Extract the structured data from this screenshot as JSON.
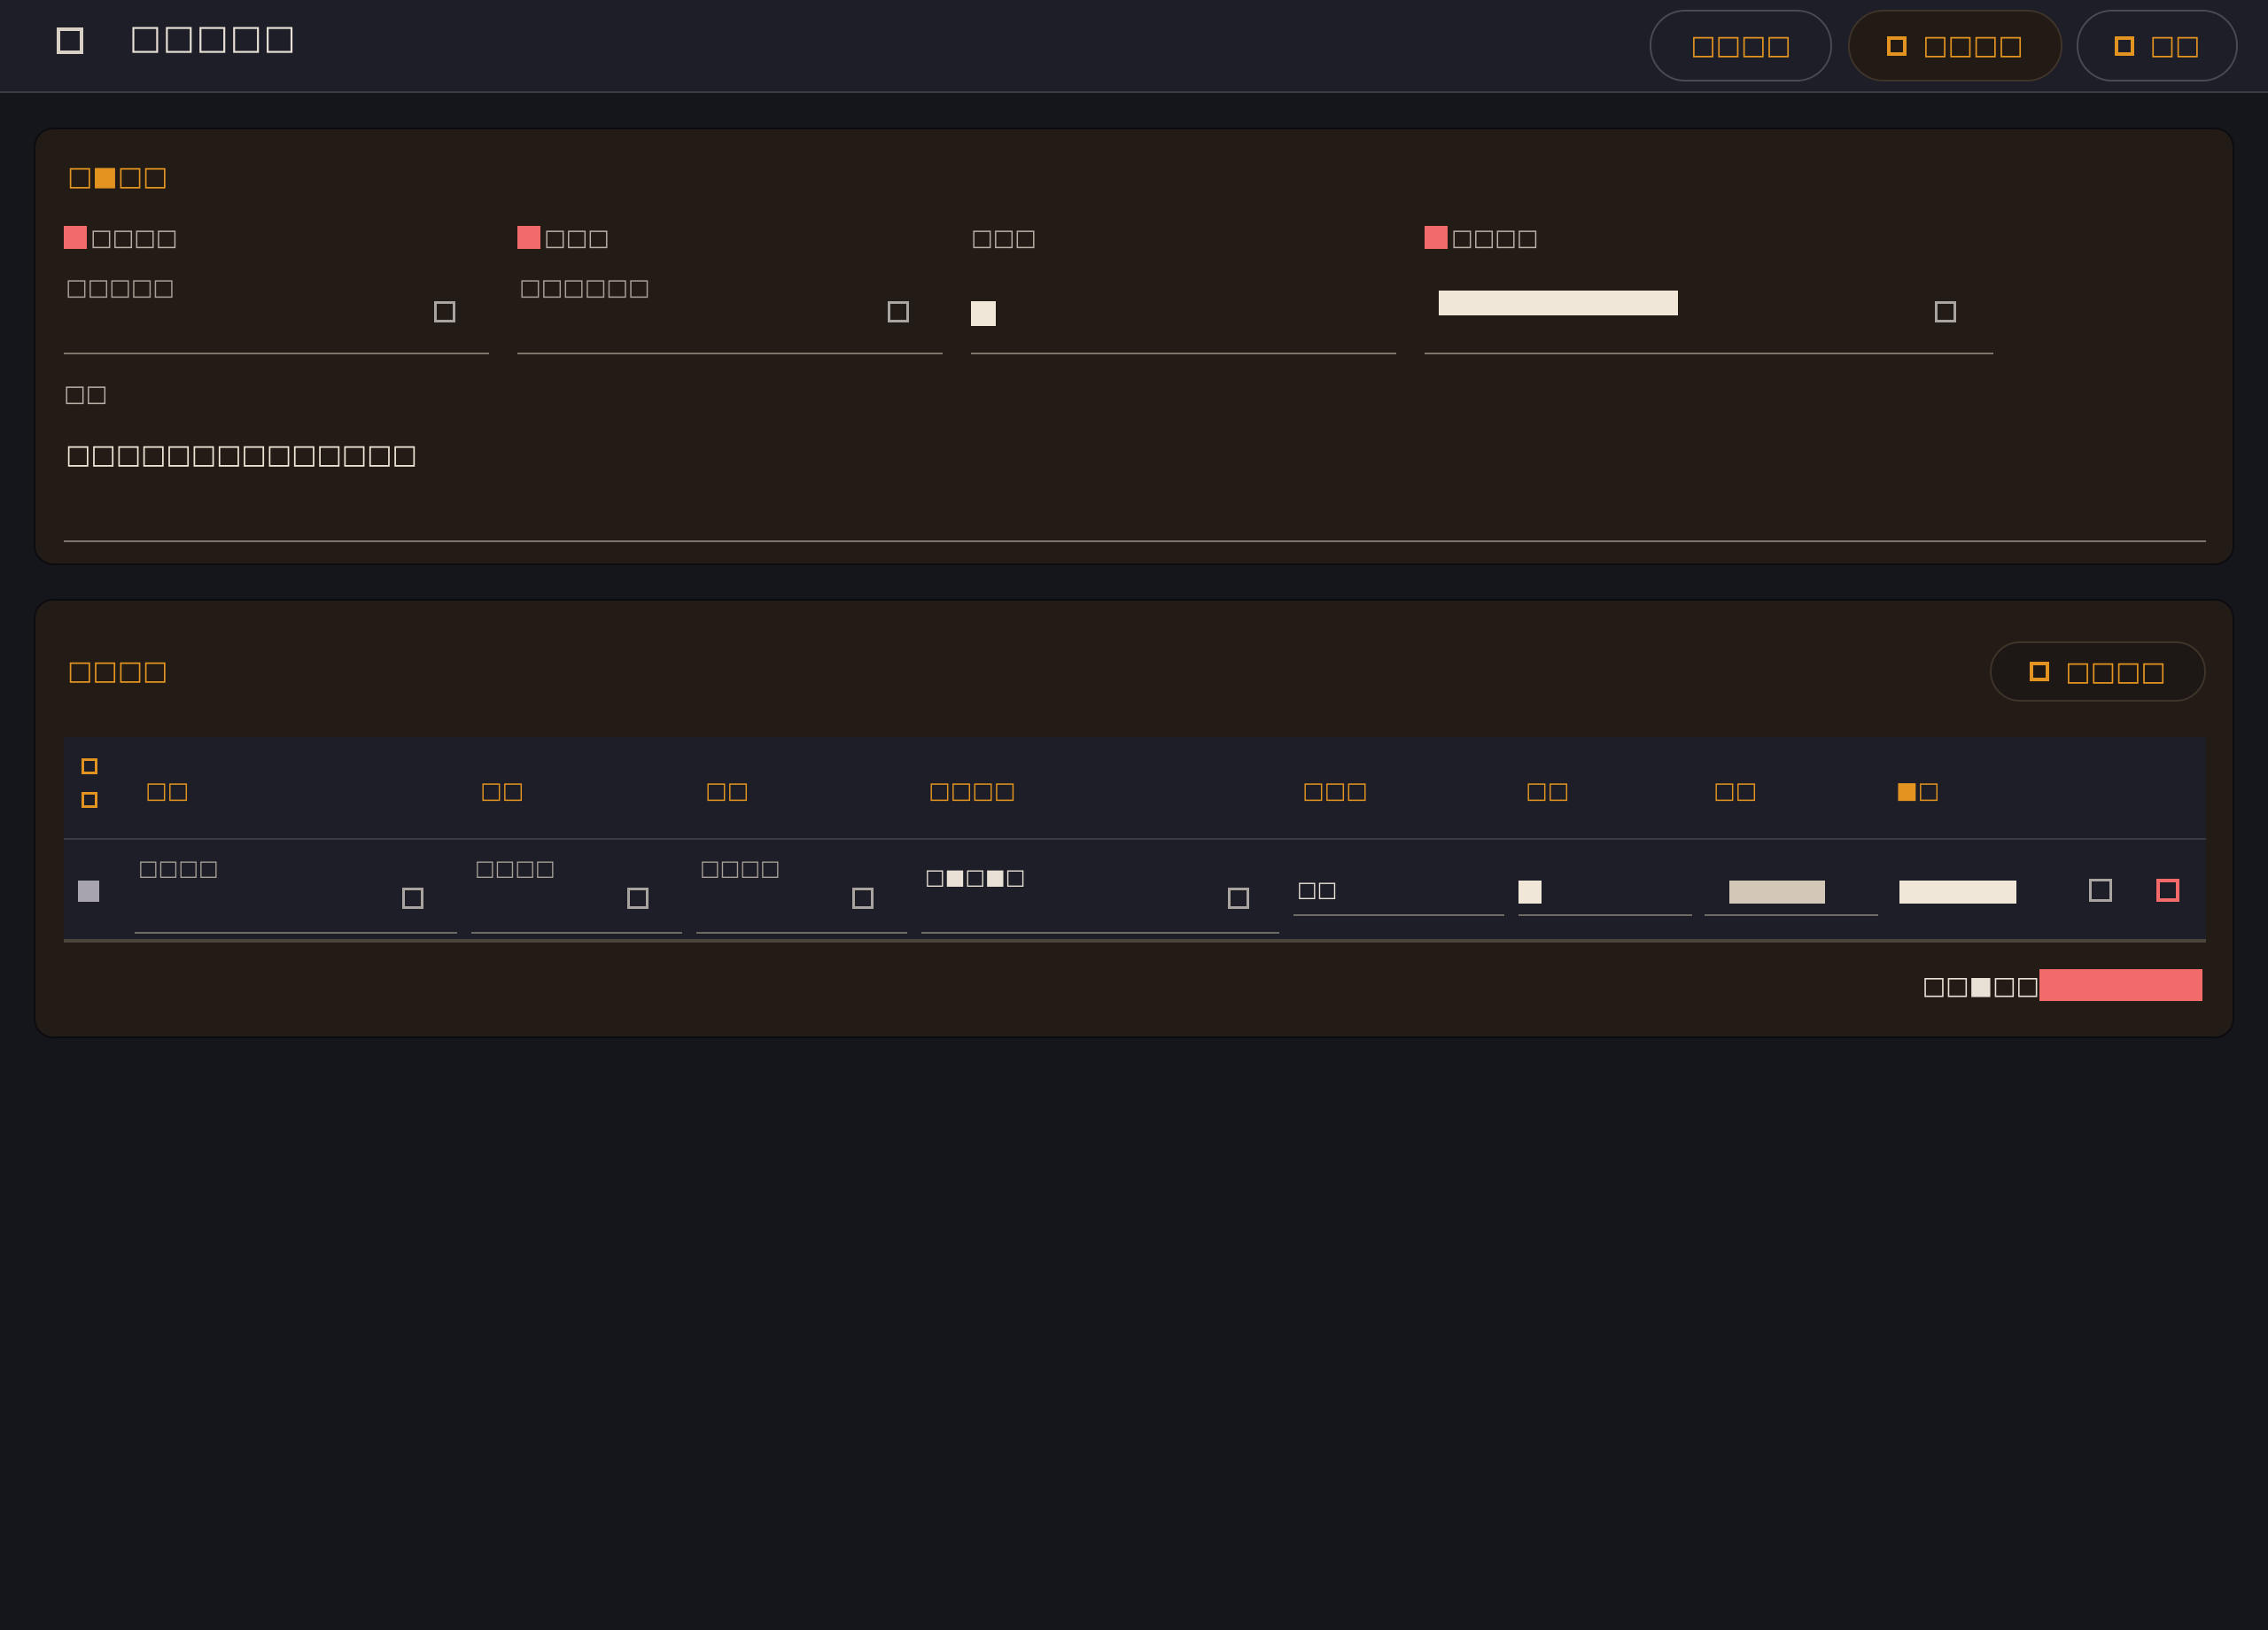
{
  "header": {
    "title": "□□□□□",
    "buttons": [
      {
        "label": "□□□□"
      },
      {
        "label": "□□□□"
      },
      {
        "label": "□□"
      }
    ]
  },
  "details": {
    "title": "□■□□",
    "fields": [
      {
        "label": "□□□□",
        "value": "□□□□□",
        "required": true
      },
      {
        "label": "□□□",
        "value": "□□□□□□",
        "required": true
      },
      {
        "label": "□□□",
        "value": "",
        "required": false
      },
      {
        "label": "□□□□",
        "value": "",
        "required": true
      }
    ],
    "notes_label": "□□",
    "notes_value": "□□□□□□□□□□□□□□"
  },
  "items": {
    "title": "□□□□",
    "add_button_label": "□□□□",
    "columns": [
      "□□",
      "□□",
      "□□",
      "□□□□",
      "□□□",
      "□□",
      "□□",
      "■□"
    ],
    "row": {
      "cells": [
        "□□□□",
        "□□□□",
        "□□□□",
        "□■□■□",
        "□□",
        "",
        "",
        ""
      ]
    },
    "total_label": "□□■□□"
  },
  "colors": {
    "accent": "#e39420",
    "danger": "#f26a6a",
    "background": "#15161b",
    "card": "#231b16"
  },
  "icons": {
    "app": "app-icon",
    "calendar": "calendar-icon",
    "delete": "trash-icon"
  }
}
